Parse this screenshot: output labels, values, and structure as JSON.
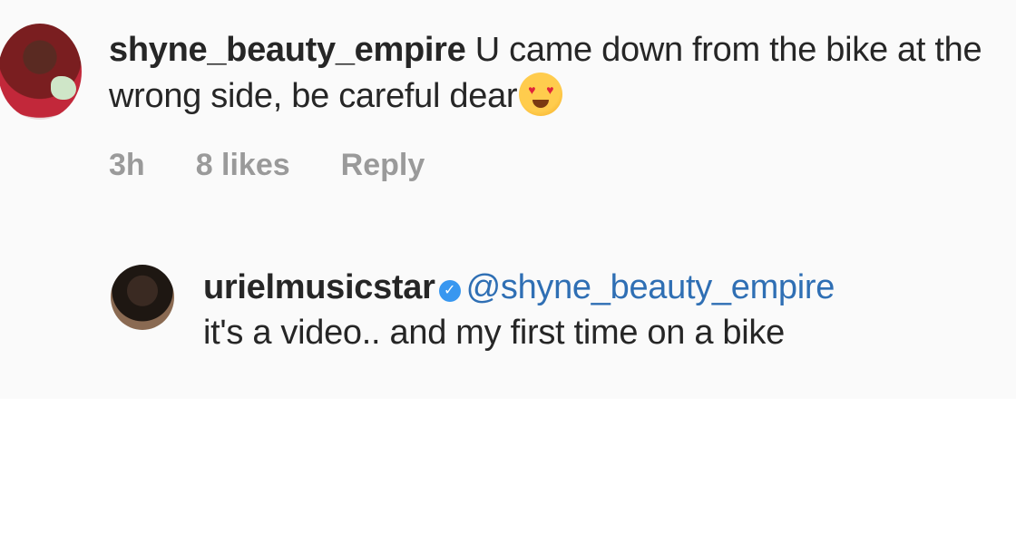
{
  "comments": [
    {
      "username": "shyne_beauty_empire",
      "text": "U came down from the bike at the wrong side, be careful dear",
      "emoji": "heart-eyes-emoji",
      "time": "3h",
      "likes": "8 likes",
      "reply_label": "Reply"
    }
  ],
  "reply": {
    "username": "urielmusicstar",
    "verified_icon": "verified-badge-icon",
    "mention": "@shyne_beauty_empire",
    "text": "it's a video.. and my first time on a bike"
  },
  "colors": {
    "text": "#262626",
    "meta": "#9a9a9a",
    "mention": "#2f6fb4",
    "verified": "#3897f0"
  }
}
